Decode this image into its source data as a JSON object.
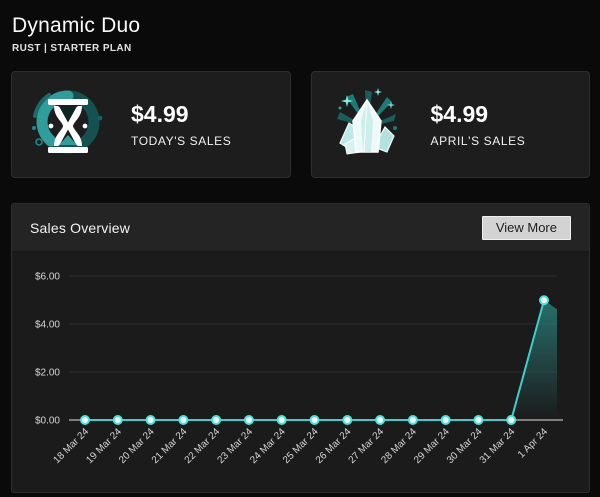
{
  "page": {
    "title": "Dynamic Duo",
    "subtitle": "RUST | STARTER PLAN"
  },
  "stats": [
    {
      "icon": "hourglass-icon",
      "value": "$4.99",
      "label": "TODAY'S SALES"
    },
    {
      "icon": "gem-icon",
      "value": "$4.99",
      "label": "APRIL'S SALES"
    }
  ],
  "sales_overview": {
    "title": "Sales Overview",
    "view_more_label": "View More"
  },
  "chart_data": {
    "type": "line",
    "title": "Sales Overview",
    "x": [
      "18 Mar 24",
      "19 Mar 24",
      "20 Mar 24",
      "21 Mar 24",
      "22 Mar 24",
      "23 Mar 24",
      "24 Mar 24",
      "25 Mar 24",
      "26 Mar 24",
      "27 Mar 24",
      "28 Mar 24",
      "29 Mar 24",
      "30 Mar 24",
      "31 Mar 24",
      "1 Apr 24"
    ],
    "series": [
      {
        "name": "Sales",
        "values": [
          0,
          0,
          0,
          0,
          0,
          0,
          0,
          0,
          0,
          0,
          0,
          0,
          0,
          0,
          4.99
        ]
      }
    ],
    "xlabel": "",
    "ylabel": "",
    "y_ticks": [
      "$0.00",
      "$2.00",
      "$4.00",
      "$6.00"
    ],
    "y_tick_values": [
      0,
      2,
      4,
      6
    ],
    "ylim": [
      0,
      6
    ],
    "grid": true,
    "legend_position": "none",
    "line_color": "#3ecfc9",
    "point_stroke": "#4be0d9",
    "point_fill": "#e9fffd",
    "area_color": "#2fa8a2",
    "grid_color": "#2b2b2b",
    "axis_color": "#a0a0a0",
    "tick_label_color": "#d6d6d6"
  },
  "colors": {
    "accent_teal": "#3ecfc9",
    "page_bg": "#0a0a0a",
    "card_bg": "#1d1d1d",
    "panel_header_bg": "#242424",
    "button_bg": "#d3d3d3"
  }
}
